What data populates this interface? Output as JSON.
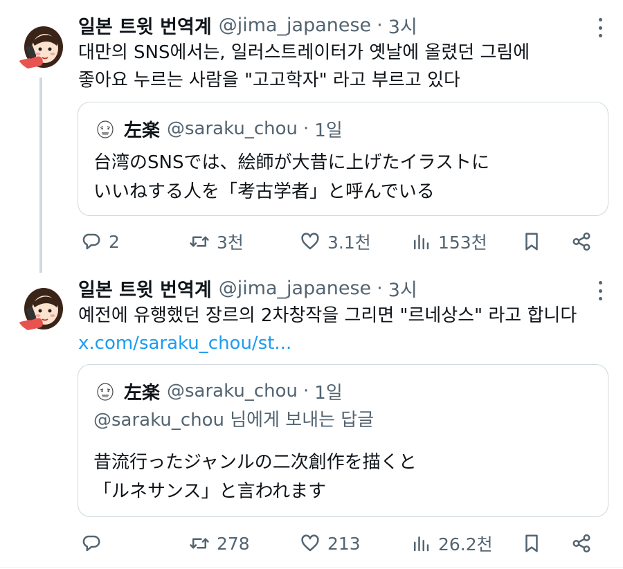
{
  "tweets": [
    {
      "author": {
        "name": "일본 트윗 번역계",
        "handle": "@jima_japanese",
        "time": "3시"
      },
      "text_lines": [
        "대만의 SNS에서는, 일러스트레이터가 옛날에 올렸던 그림에",
        "좋아요 누르는 사람을 \"고고학자\" 라고 부르고 있다"
      ],
      "quote": {
        "author": {
          "name": "左楽",
          "handle": "@saraku_chou",
          "time": "1일"
        },
        "text_lines": [
          "台湾のSNSでは、絵師が大昔に上げたイラストに",
          "いいねする人を「考古学者」と呼んでいる"
        ]
      },
      "actions": {
        "replies": "2",
        "retweets": "3천",
        "likes": "3.1천",
        "views": "153천"
      }
    },
    {
      "author": {
        "name": "일본 트윗 번역계",
        "handle": "@jima_japanese",
        "time": "3시"
      },
      "text_lines": [
        "예전에 유행했던 장르의 2차창작을 그리면 \"르네상스\" 라고 합니다"
      ],
      "link": "x.com/saraku_chou/st...",
      "quote": {
        "author": {
          "name": "左楽",
          "handle": "@saraku_chou",
          "time": "1일"
        },
        "reply_to": "@saraku_chou 님에게 보내는 답글",
        "text_lines": [
          "昔流行ったジャンルの二次創作を描くと",
          "「ルネサンス」と言われます"
        ]
      },
      "actions": {
        "replies": "",
        "retweets": "278",
        "likes": "213",
        "views": "26.2천"
      }
    }
  ],
  "colors": {
    "text": "#0f1419",
    "secondary": "#536471",
    "link": "#1d9bf0",
    "border": "#cfd9de"
  },
  "icons": {
    "reply": "speech-bubble-icon",
    "retweet": "retweet-arrows-icon",
    "like": "heart-icon",
    "views": "bar-chart-icon",
    "bookmark": "bookmark-icon",
    "share": "share-nodes-icon",
    "more": "vertical-dots-icon"
  }
}
